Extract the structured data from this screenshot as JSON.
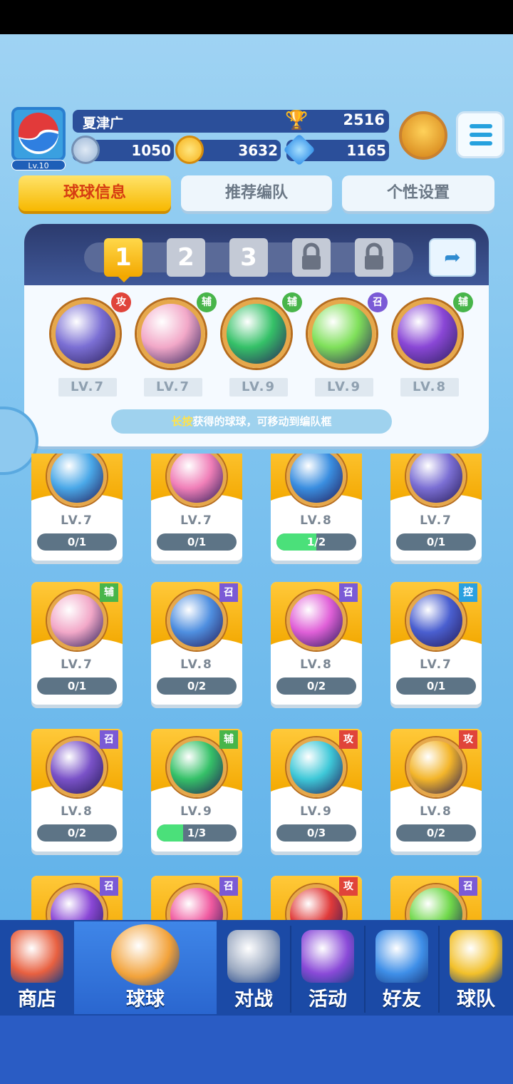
{
  "player": {
    "name": "夏津广",
    "level": "Lv.10",
    "trophies": "2516"
  },
  "resources": [
    {
      "icon": "energy-icon",
      "value": "1050",
      "color": "#9ab6d6"
    },
    {
      "icon": "gold-coin-icon",
      "value": "3632",
      "color": "#f6c22a"
    },
    {
      "icon": "diamond-icon",
      "value": "1165",
      "color": "#3fa2f0"
    }
  ],
  "tabs": [
    "球球信息",
    "推荐编队",
    "个性设置"
  ],
  "team": {
    "slots": [
      "1",
      "2",
      "3"
    ],
    "active_slot": "1",
    "balls": [
      {
        "tag": "攻",
        "tag_color": "#e0443a",
        "color": "#7b6fd4",
        "level": "LV.7"
      },
      {
        "tag": "辅",
        "tag_color": "#48b54a",
        "color": "#f2a8c8",
        "level": "LV.7"
      },
      {
        "tag": "辅",
        "tag_color": "#48b54a",
        "color": "#35c168",
        "level": "LV.9"
      },
      {
        "tag": "召",
        "tag_color": "#7a5ad6",
        "color": "#7fe05a",
        "level": "LV.9"
      },
      {
        "tag": "辅",
        "tag_color": "#48b54a",
        "color": "#8a47d6",
        "level": "LV.8"
      }
    ],
    "hint_highlight": "长按",
    "hint_text": "获得的球球，可移动到编队框"
  },
  "cards": [
    {
      "tag": "",
      "color": "#4aa8e8",
      "level": "LV.7",
      "progress": "0/1",
      "fill": 0
    },
    {
      "tag": "",
      "color": "#f07fb8",
      "level": "LV.7",
      "progress": "0/1",
      "fill": 0
    },
    {
      "tag": "",
      "color": "#3a8ee0",
      "level": "LV.8",
      "progress": "1/2",
      "fill": 0.5
    },
    {
      "tag": "",
      "color": "#7b6fd4",
      "level": "LV.7",
      "progress": "0/1",
      "fill": 0
    },
    {
      "tag": "辅",
      "tag_color": "#48b54a",
      "color": "#f2a8c8",
      "level": "LV.7",
      "progress": "0/1",
      "fill": 0
    },
    {
      "tag": "召",
      "tag_color": "#7a5ad6",
      "color": "#4f8fe0",
      "level": "LV.8",
      "progress": "0/2",
      "fill": 0
    },
    {
      "tag": "召",
      "tag_color": "#7a5ad6",
      "color": "#e060d8",
      "level": "LV.8",
      "progress": "0/2",
      "fill": 0
    },
    {
      "tag": "控",
      "tag_color": "#2aa0e0",
      "color": "#4a5fd0",
      "level": "LV.7",
      "progress": "0/1",
      "fill": 0
    },
    {
      "tag": "召",
      "tag_color": "#7a5ad6",
      "color": "#7a52c8",
      "level": "LV.8",
      "progress": "0/2",
      "fill": 0
    },
    {
      "tag": "辅",
      "tag_color": "#48b54a",
      "color": "#35c168",
      "level": "LV.9",
      "progress": "1/3",
      "fill": 0.333
    },
    {
      "tag": "攻",
      "tag_color": "#e0443a",
      "color": "#3ec8d8",
      "level": "LV.9",
      "progress": "0/3",
      "fill": 0
    },
    {
      "tag": "攻",
      "tag_color": "#e0443a",
      "color": "#f3b52a",
      "level": "LV.8",
      "progress": "0/2",
      "fill": 0
    },
    {
      "tag": "召",
      "tag_color": "#7a5ad6",
      "color": "#8a47d6",
      "level": "",
      "progress": "",
      "fill": 0
    },
    {
      "tag": "召",
      "tag_color": "#7a5ad6",
      "color": "#f05aa0",
      "level": "",
      "progress": "",
      "fill": 0
    },
    {
      "tag": "攻",
      "tag_color": "#e0443a",
      "color": "#e03a3a",
      "level": "",
      "progress": "",
      "fill": 0
    },
    {
      "tag": "召",
      "tag_color": "#7a5ad6",
      "color": "#6fd84a",
      "level": "",
      "progress": "",
      "fill": 0
    }
  ],
  "nav": [
    {
      "label": "商店",
      "icon": "shop-icon",
      "color": "#e86040"
    },
    {
      "label": "球球",
      "icon": "balls-icon",
      "color": "#f2a23a",
      "active": true
    },
    {
      "label": "对战",
      "icon": "swords-icon",
      "color": "#9aa8c0"
    },
    {
      "label": "活动",
      "icon": "party-popper-icon",
      "color": "#8a4ad8"
    },
    {
      "label": "好友",
      "icon": "friends-icon",
      "color": "#3f8fe8"
    },
    {
      "label": "球队",
      "icon": "whistle-icon",
      "color": "#f2c02a"
    }
  ]
}
